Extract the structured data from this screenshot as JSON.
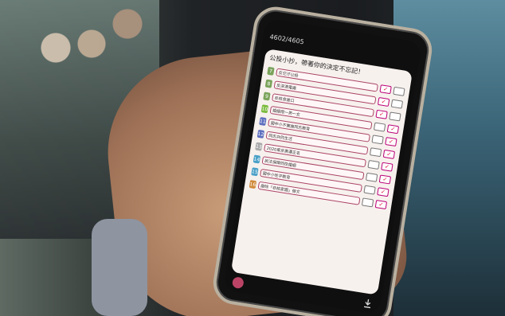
{
  "statusbar": {
    "time": "",
    "battery": ""
  },
  "counter": "4602/4605",
  "screen": {
    "title": "公投小抄，帶著你的決定不忘記！",
    "column_labels": {
      "agree": "",
      "disagree": ""
    },
    "items": [
      {
        "num": "7",
        "label": "反空汙公投",
        "num_color": "#7aa35b"
      },
      {
        "num": "8",
        "label": "反深澳電廠",
        "num_color": "#7aa35b"
      },
      {
        "num": "9",
        "label": "反核食進口",
        "num_color": "#7aa35b"
      },
      {
        "num": "10",
        "label": "婚姻限一男一女",
        "num_color": "#7bbb3e"
      },
      {
        "num": "11",
        "label": "國中小不實施同志教育",
        "num_color": "#5e6fbf"
      },
      {
        "num": "12",
        "label": "同志共同生活",
        "num_color": "#5e6fbf"
      },
      {
        "num": "13",
        "label": "2020東京奧運正名",
        "num_color": "#a9a9a9"
      },
      {
        "num": "14",
        "label": "民法保障同性婚姻",
        "num_color": "#4aa0c8"
      },
      {
        "num": "15",
        "label": "國中小性平教育",
        "num_color": "#4aa0c8"
      },
      {
        "num": "16",
        "label": "廢除「非核家園」條文",
        "num_color": "#d08a3a"
      }
    ],
    "footer_note": ""
  }
}
